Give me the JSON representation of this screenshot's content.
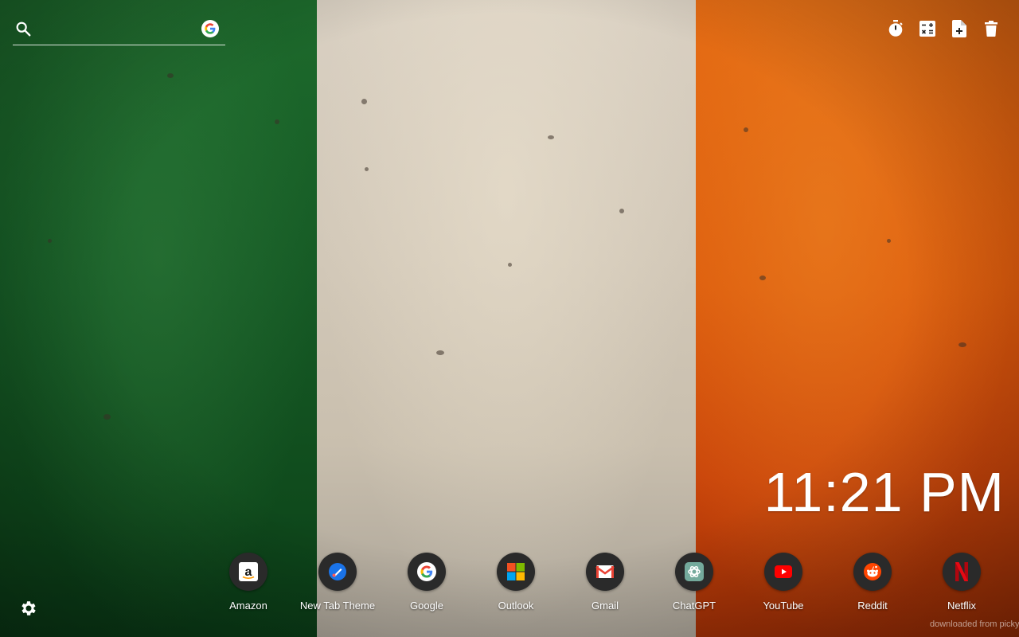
{
  "search": {
    "value": "",
    "placeholder": ""
  },
  "tools": [
    {
      "icon": "timer-icon"
    },
    {
      "icon": "calculator-icon"
    },
    {
      "icon": "add-note-icon"
    },
    {
      "icon": "trash-icon"
    }
  ],
  "clock": {
    "time": "11:21 PM"
  },
  "dock": {
    "apps": [
      {
        "label": "Amazon",
        "icon": "amazon-icon"
      },
      {
        "label": "New Tab Theme",
        "icon": "new-tab-theme-icon"
      },
      {
        "label": "Google",
        "icon": "google-icon"
      },
      {
        "label": "Outlook",
        "icon": "microsoft-icon"
      },
      {
        "label": "Gmail",
        "icon": "gmail-icon"
      },
      {
        "label": "ChatGPT",
        "icon": "chatgpt-icon"
      },
      {
        "label": "YouTube",
        "icon": "youtube-icon"
      },
      {
        "label": "Reddit",
        "icon": "reddit-icon"
      },
      {
        "label": "Netflix",
        "icon": "netflix-icon"
      }
    ]
  },
  "footer": {
    "credit": "downloaded from pickyw"
  },
  "colors": {
    "flag_green": "#165a25",
    "flag_white": "#d2c8b8",
    "flag_orange": "#dc5a0c",
    "icon_circle": "#2a2a2a"
  }
}
